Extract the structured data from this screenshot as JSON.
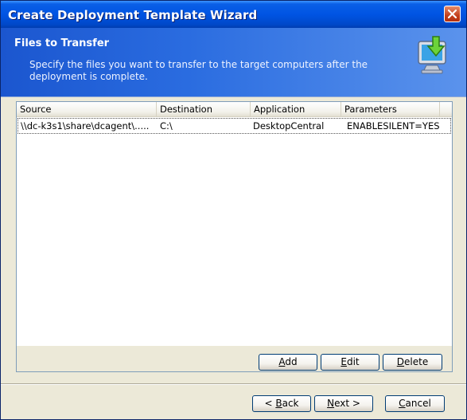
{
  "window": {
    "title": "Create Deployment Template Wizard"
  },
  "header": {
    "title": "Files to Transfer",
    "description": "Specify the files you want to transfer to the target computers after the deployment is complete.",
    "icon": "computer-download-icon"
  },
  "table": {
    "columns": [
      "Source",
      "Destination",
      "Application",
      "Parameters"
    ],
    "rows": [
      {
        "source": "\\\\dc-k3s1\\share\\dcagent\\.....",
        "destination": "C:\\",
        "application": "DesktopCentral",
        "parameters": "ENABLESILENT=YES"
      }
    ]
  },
  "list_buttons": {
    "add": {
      "accel": "A",
      "rest": "dd"
    },
    "edit": {
      "accel": "E",
      "rest": "dit"
    },
    "delete": {
      "accel": "D",
      "rest": "elete"
    }
  },
  "footer_buttons": {
    "back": {
      "prefix": "< ",
      "accel": "B",
      "rest": "ack"
    },
    "next": {
      "accel": "N",
      "rest": "ext >"
    },
    "cancel": {
      "accel": "C",
      "rest": "ancel"
    }
  },
  "colors": {
    "titlebar": "#0054e3",
    "header": "#2a6ce0",
    "face": "#ece9d8",
    "close": "#c3401d"
  }
}
